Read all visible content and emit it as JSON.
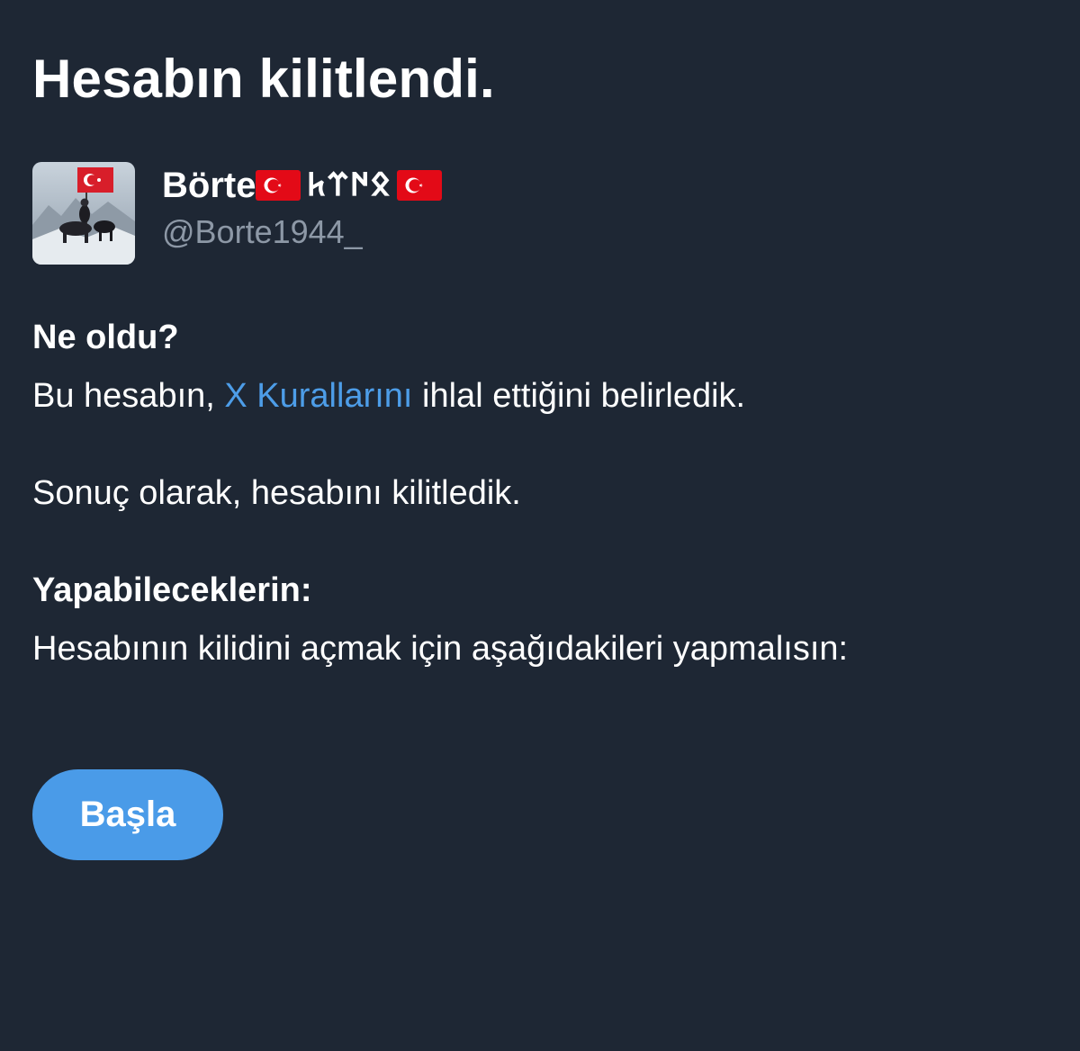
{
  "header": {
    "title": "Hesabın kilitlendi."
  },
  "account": {
    "display_name_prefix": "Börte",
    "display_name_runic": "𐰋𐰇𐰼𐱅",
    "handle": "@Borte1944_",
    "flag_icon": "turkish-flag-icon",
    "flag_color": "#e30a17"
  },
  "what_happened": {
    "heading": "Ne oldu?",
    "line1_before": "Bu hesabın, ",
    "line1_link": "X Kurallarını",
    "line1_after": " ihlal ettiğini belirledik.",
    "line2": "Sonuç olarak, hesabını kilitledik."
  },
  "what_you_can_do": {
    "heading": "Yapabileceklerin:",
    "line": "Hesabının kilidini açmak için aşağıdakileri yapmalısın:"
  },
  "actions": {
    "start_label": "Başla"
  },
  "colors": {
    "background": "#1e2734",
    "link": "#4d9de8",
    "button": "#4a9be8",
    "handle": "#8d98a6"
  }
}
